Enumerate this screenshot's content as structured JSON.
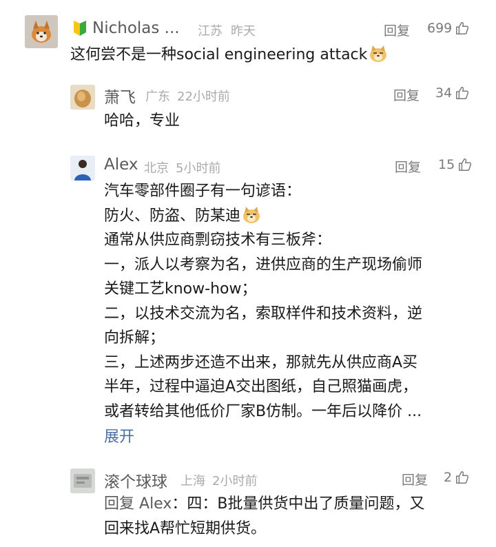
{
  "comments": [
    {
      "author": "Nicholas ...",
      "location": "江苏",
      "time": "昨天",
      "reply_label": "回复",
      "likes": "699",
      "lines": [
        "这何尝不是一种social engineering attack"
      ]
    },
    {
      "author": "萧飞",
      "location": "广东",
      "time": "22小时前",
      "reply_label": "回复",
      "likes": "34",
      "lines": [
        "哈哈，专业"
      ]
    },
    {
      "author": "Alex",
      "location": "北京",
      "time": "5小时前",
      "reply_label": "回复",
      "likes": "15",
      "lines": [
        "汽车零部件圈子有一句谚语：",
        "防火、防盗、防某迪",
        "通常从供应商剽窃技术有三板斧：",
        "一，派人以考察为名，进供应商的生产现场偷师",
        "关键工艺know-how；",
        "二，以技术交流为名，索取样件和技术资料，逆",
        "向拆解；",
        "三，上述两步还造不出来，那就先从供应商A买",
        "半年，过程中逼迫A交出图纸，自己照猫画虎，",
        "或者转给其他低价厂家B仿制。一年后以降价 ..."
      ],
      "expand_label": "展开"
    },
    {
      "author": "滚个球球",
      "location": "上海",
      "time": "2小时前",
      "reply_label": "回复",
      "likes": "2",
      "reply_prefix": "回复",
      "reply_target": "Alex",
      "lines": [
        "：四：B批量供货中出了质量问题，又",
        "回来找A帮忙短期供货。"
      ]
    }
  ],
  "colors": {
    "link": "#4a6fa5",
    "muted": "#aaaaaa",
    "name": "#5a5a5a"
  }
}
